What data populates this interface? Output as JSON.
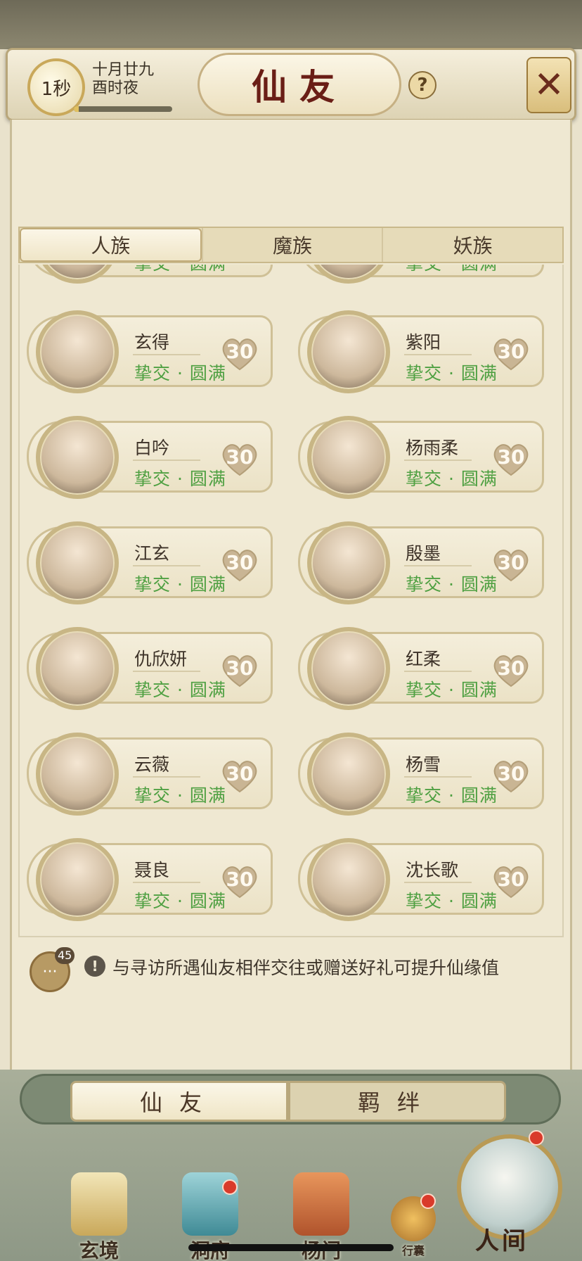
{
  "header": {
    "timer": "1秒",
    "date_line1": "十月廿九",
    "date_line2": "酉时夜",
    "time_progress": 0.05,
    "title": "仙友",
    "help": "?",
    "close": "✕"
  },
  "tabs": [
    "人族",
    "魔族",
    "妖族"
  ],
  "active_tab": "人族",
  "friends": [
    {
      "name": "玄得",
      "status": "挚交 · 圆满",
      "affinity": "30"
    },
    {
      "name": "紫阳",
      "status": "挚交 · 圆满",
      "affinity": "30"
    },
    {
      "name": "白吟",
      "status": "挚交 · 圆满",
      "affinity": "30"
    },
    {
      "name": "杨雨柔",
      "status": "挚交 · 圆满",
      "affinity": "30"
    },
    {
      "name": "江玄",
      "status": "挚交 · 圆满",
      "affinity": "30"
    },
    {
      "name": "殷墨",
      "status": "挚交 · 圆满",
      "affinity": "30"
    },
    {
      "name": "仇欣妍",
      "status": "挚交 · 圆满",
      "affinity": "30"
    },
    {
      "name": "红柔",
      "status": "挚交 · 圆满",
      "affinity": "30"
    },
    {
      "name": "云薇",
      "status": "挚交 · 圆满",
      "affinity": "30"
    },
    {
      "name": "杨雪",
      "status": "挚交 · 圆满",
      "affinity": "30"
    },
    {
      "name": "聂良",
      "status": "挚交 · 圆满",
      "affinity": "30"
    },
    {
      "name": "沈长歌",
      "status": "挚交 · 圆满",
      "affinity": "30"
    }
  ],
  "partial_row": {
    "status": "挚交 · 圆满"
  },
  "hint": {
    "chat_count": "45",
    "text": "与寻访所遇仙友相伴交往或赠送好礼可提升仙缘值"
  },
  "bottom_tabs": [
    "仙友",
    "羁绊"
  ],
  "nav": {
    "items": [
      "玄境",
      "洞府",
      "杨门",
      "行囊"
    ],
    "main": "人间"
  },
  "colors": {
    "status_green": "#4fa042",
    "title_red": "#6a1e16",
    "heart": "#c9b594"
  }
}
